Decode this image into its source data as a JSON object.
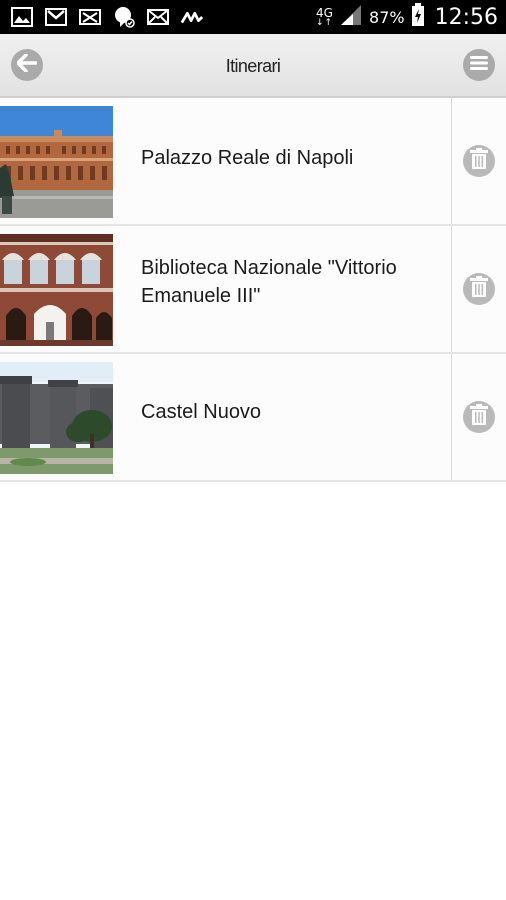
{
  "status_bar": {
    "network_type": "4G",
    "network_arrows": "↓↑",
    "battery_percent": "87%",
    "time": "12:56",
    "notification_icons": [
      "gallery-icon",
      "gmail-icon",
      "missed-call-icon",
      "hangouts-icon",
      "email-icon",
      "app-icon"
    ]
  },
  "header": {
    "title": "Itinerari",
    "back_icon": "arrow-left-icon",
    "menu_icon": "hamburger-menu-icon"
  },
  "items": [
    {
      "title": "Palazzo Reale di Napoli",
      "thumbnail": "palazzo-reale-photo"
    },
    {
      "title": "Biblioteca Nazionale \"Vittorio Emanuele III\"",
      "thumbnail": "biblioteca-nazionale-photo"
    },
    {
      "title": "Castel Nuovo",
      "thumbnail": "castel-nuovo-photo"
    }
  ],
  "colors": {
    "status_bar_bg": "#000000",
    "header_bg": "#e6e6e6",
    "button_gray": "#aaaaaa",
    "row_bg": "#fcfcfc",
    "divider": "#e4e4e4"
  }
}
